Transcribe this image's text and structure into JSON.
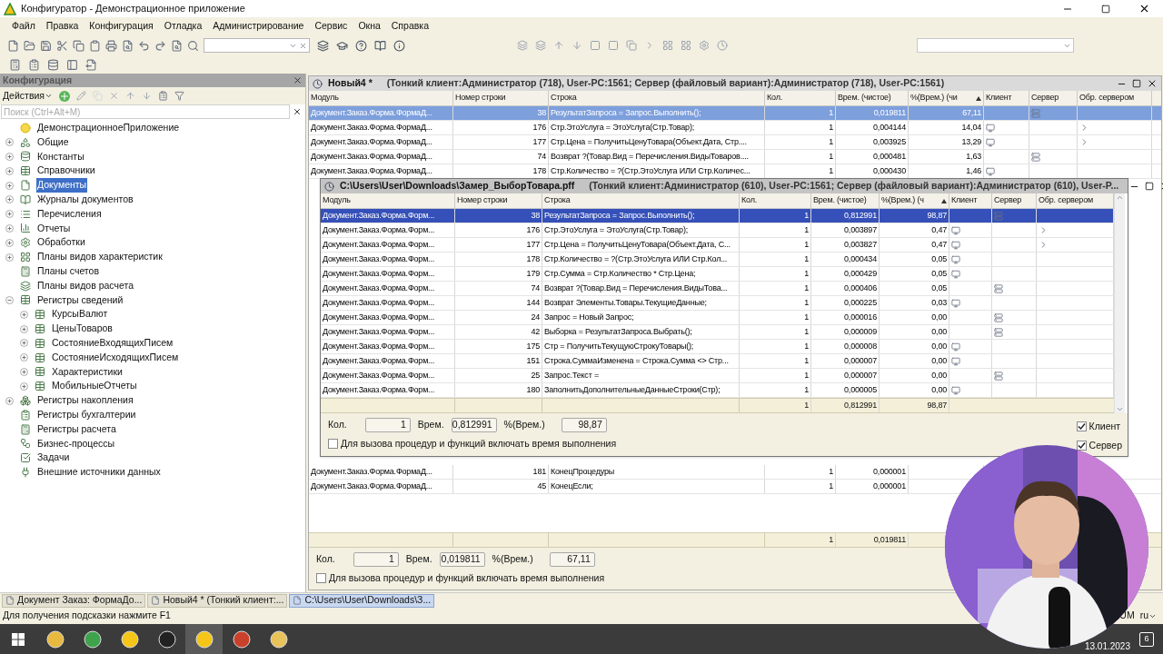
{
  "window": {
    "title": "Конфигуратор - Демонстрационное приложение"
  },
  "menu": [
    "Файл",
    "Правка",
    "Конфигурация",
    "Отладка",
    "Администрирование",
    "Сервис",
    "Окна",
    "Справка"
  ],
  "config_panel": {
    "title": "Конфигурация",
    "actions_label": "Действия",
    "search": {
      "placeholder": "Поиск (Ctrl+Alt+M)"
    },
    "tree": [
      {
        "label": "ДемонстрационноеПриложение",
        "selected": false,
        "children": [
          {
            "label": "Общие",
            "expanded": false,
            "selected": false
          },
          {
            "label": "Константы",
            "expanded": false,
            "selected": false
          },
          {
            "label": "Справочники",
            "expanded": false,
            "selected": false
          },
          {
            "label": "Документы",
            "expanded": false,
            "selected": true
          },
          {
            "label": "Журналы документов",
            "expanded": false,
            "selected": false
          },
          {
            "label": "Перечисления",
            "expanded": false,
            "selected": false
          },
          {
            "label": "Отчеты",
            "expanded": false,
            "selected": false
          },
          {
            "label": "Обработки",
            "expanded": false,
            "selected": false
          },
          {
            "label": "Планы видов характеристик",
            "expanded": false,
            "selected": false
          },
          {
            "label": "Планы счетов",
            "selected": false
          },
          {
            "label": "Планы видов расчета",
            "selected": false
          },
          {
            "label": "Регистры сведений",
            "expanded": true,
            "selected": false,
            "children": [
              {
                "label": "КурсыВалют",
                "expanded": false,
                "selected": false
              },
              {
                "label": "ЦеныТоваров",
                "expanded": false,
                "selected": false
              },
              {
                "label": "СостояниеВходящихПисем",
                "expanded": false,
                "selected": false
              },
              {
                "label": "СостояниеИсходящихПисем",
                "expanded": false,
                "selected": false
              },
              {
                "label": "Характеристики",
                "expanded": false,
                "selected": false
              },
              {
                "label": "МобильныеОтчеты",
                "expanded": false,
                "selected": false
              }
            ]
          },
          {
            "label": "Регистры накопления",
            "expanded": false,
            "selected": false
          },
          {
            "label": "Регистры бухгалтерии",
            "selected": false
          },
          {
            "label": "Регистры расчета",
            "selected": false
          },
          {
            "label": "Бизнес-процессы",
            "selected": false
          },
          {
            "label": "Задачи",
            "selected": false
          },
          {
            "label": "Внешние источники данных",
            "selected": false
          }
        ]
      }
    ]
  },
  "back_window": {
    "active": false,
    "title": "Новый4 *",
    "subtitle": "(Тонкий клиент:Администратор (718), User-PC:1561; Сервер (файловый вариант):Администратор (718), User-PC:1561)",
    "columns": [
      {
        "label": "Модуль",
        "sorted": false
      },
      {
        "label": "Номер строки",
        "sorted": false
      },
      {
        "label": "Строка",
        "sorted": false
      },
      {
        "label": "Кол.",
        "sorted": false
      },
      {
        "label": "Врем. (чистое)",
        "sorted": false
      },
      {
        "label": "%(Врем.) (чи",
        "sorted": true
      },
      {
        "label": "Клиент",
        "sorted": false
      },
      {
        "label": "Сервер",
        "sorted": false
      },
      {
        "label": "Обр. сервером",
        "sorted": false
      }
    ],
    "rows": [
      {
        "module": "Документ.Заказ.Форма.ФормаД...",
        "line": "38",
        "code": "РезультатЗапроса = Запрос.Выполнить();",
        "count": "1",
        "time": "0,019811",
        "percent": "67,11",
        "client": false,
        "server": true,
        "server_call": false,
        "selected": true
      },
      {
        "module": "Документ.Заказ.Форма.ФормаД...",
        "line": "176",
        "code": "Стр.ЭтоУслуга = ЭтоУслуга(Стр.Товар);",
        "count": "1",
        "time": "0,004144",
        "percent": "14,04",
        "client": true,
        "server": false,
        "server_call": true,
        "selected": false
      },
      {
        "module": "Документ.Заказ.Форма.ФормаД...",
        "line": "177",
        "code": "Стр.Цена = ПолучитьЦенуТовара(Объект.Дата, Стр....",
        "count": "1",
        "time": "0,003925",
        "percent": "13,29",
        "client": true,
        "server": false,
        "server_call": true,
        "selected": false
      },
      {
        "module": "Документ.Заказ.Форма.ФормаД...",
        "line": "74",
        "code": "Возврат ?(Товар.Вид = Перечисления.ВидыТоваров....",
        "count": "1",
        "time": "0,000481",
        "percent": "1,63",
        "client": false,
        "server": true,
        "server_call": false,
        "selected": false
      },
      {
        "module": "Документ.Заказ.Форма.ФормаД...",
        "line": "178",
        "code": "Стр.Количество = ?(Стр.ЭтоУслуга ИЛИ Стр.Количес...",
        "count": "1",
        "time": "0,000430",
        "percent": "1,46",
        "client": true,
        "server": false,
        "server_call": false,
        "selected": false
      }
    ],
    "lower_rows": [
      {
        "module": "Документ.Заказ.Форма.ФормаД...",
        "line": "181",
        "code": "КонецПроцедуры",
        "count": "1",
        "time": "0,000001",
        "selected": false
      },
      {
        "module": "Документ.Заказ.Форма.ФормаД...",
        "line": "45",
        "code": "КонецЕсли;",
        "count": "1",
        "time": "0,000001",
        "selected": false
      }
    ],
    "totals": {
      "count": "1",
      "time": "0,019811"
    },
    "summary": {
      "count_label": "Кол.",
      "count": "1",
      "time_label": "Врем.",
      "time": "0,019811",
      "percent_label": "%(Врем.)",
      "percent": "67,11"
    },
    "include_time": {
      "label": "Для вызова процедур и функций включать время выполнения",
      "checked": false
    }
  },
  "front_window": {
    "active": true,
    "title": "C:\\Users\\User\\Downloads\\Замер_ВыборТовара.pff",
    "subtitle": "(Тонкий клиент:Администратор (610), User-PC:1561; Сервер (файловый вариант):Администратор (610), User-P...",
    "columns": [
      {
        "label": "Модуль",
        "sorted": false
      },
      {
        "label": "Номер строки",
        "sorted": false
      },
      {
        "label": "Строка",
        "sorted": false
      },
      {
        "label": "Кол.",
        "sorted": false
      },
      {
        "label": "Врем. (чистое)",
        "sorted": false
      },
      {
        "label": "%(Врем.) (ч",
        "sorted": true
      },
      {
        "label": "Клиент",
        "sorted": false
      },
      {
        "label": "Сервер",
        "sorted": false
      },
      {
        "label": "Обр. сервером",
        "sorted": false
      }
    ],
    "rows": [
      {
        "module": "Документ.Заказ.Форма.Форм...",
        "line": "38",
        "code": "РезультатЗапроса = Запрос.Выполнить();",
        "count": "1",
        "time": "0,812991",
        "percent": "98,87",
        "client": false,
        "server": true,
        "server_call": false,
        "selected": true
      },
      {
        "module": "Документ.Заказ.Форма.Форм...",
        "line": "176",
        "code": "Стр.ЭтоУслуга = ЭтоУслуга(Стр.Товар);",
        "count": "1",
        "time": "0,003897",
        "percent": "0,47",
        "client": true,
        "server": false,
        "server_call": true,
        "selected": false
      },
      {
        "module": "Документ.Заказ.Форма.Форм...",
        "line": "177",
        "code": "Стр.Цена = ПолучитьЦенуТовара(Объект.Дата, С...",
        "count": "1",
        "time": "0,003827",
        "percent": "0,47",
        "client": true,
        "server": false,
        "server_call": true,
        "selected": false
      },
      {
        "module": "Документ.Заказ.Форма.Форм...",
        "line": "178",
        "code": "Стр.Количество = ?(Стр.ЭтоУслуга ИЛИ Стр.Кол...",
        "count": "1",
        "time": "0,000434",
        "percent": "0,05",
        "client": true,
        "server": false,
        "server_call": false,
        "selected": false
      },
      {
        "module": "Документ.Заказ.Форма.Форм...",
        "line": "179",
        "code": "Стр.Сумма = Стр.Количество * Стр.Цена;",
        "count": "1",
        "time": "0,000429",
        "percent": "0,05",
        "client": true,
        "server": false,
        "server_call": false,
        "selected": false
      },
      {
        "module": "Документ.Заказ.Форма.Форм...",
        "line": "74",
        "code": "Возврат ?(Товар.Вид = Перечисления.ВидыТова...",
        "count": "1",
        "time": "0,000406",
        "percent": "0,05",
        "client": false,
        "server": true,
        "server_call": false,
        "selected": false
      },
      {
        "module": "Документ.Заказ.Форма.Форм...",
        "line": "144",
        "code": "Возврат Элементы.Товары.ТекущиеДанные;",
        "count": "1",
        "time": "0,000225",
        "percent": "0,03",
        "client": true,
        "server": false,
        "server_call": false,
        "selected": false
      },
      {
        "module": "Документ.Заказ.Форма.Форм...",
        "line": "24",
        "code": "Запрос = Новый Запрос;",
        "count": "1",
        "time": "0,000016",
        "percent": "0,00",
        "client": false,
        "server": true,
        "server_call": false,
        "selected": false
      },
      {
        "module": "Документ.Заказ.Форма.Форм...",
        "line": "42",
        "code": "Выборка = РезультатЗапроса.Выбрать();",
        "count": "1",
        "time": "0,000009",
        "percent": "0,00",
        "client": false,
        "server": true,
        "server_call": false,
        "selected": false
      },
      {
        "module": "Документ.Заказ.Форма.Форм...",
        "line": "175",
        "code": "Стр = ПолучитьТекущуюСтрокуТовары();",
        "count": "1",
        "time": "0,000008",
        "percent": "0,00",
        "client": true,
        "server": false,
        "server_call": false,
        "selected": false
      },
      {
        "module": "Документ.Заказ.Форма.Форм...",
        "line": "151",
        "code": "Строка.СуммаИзменена = Строка.Сумма <> Стр...",
        "count": "1",
        "time": "0,000007",
        "percent": "0,00",
        "client": true,
        "server": false,
        "server_call": false,
        "selected": false
      },
      {
        "module": "Документ.Заказ.Форма.Форм...",
        "line": "25",
        "code": "Запрос.Текст =",
        "count": "1",
        "time": "0,000007",
        "percent": "0,00",
        "client": false,
        "server": true,
        "server_call": false,
        "selected": false
      },
      {
        "module": "Документ.Заказ.Форма.Форм...",
        "line": "180",
        "code": "ЗаполнитьДополнительныеДанныеСтроки(Стр);",
        "count": "1",
        "time": "0,000005",
        "percent": "0,00",
        "client": true,
        "server": false,
        "server_call": false,
        "selected": false
      }
    ],
    "totals": {
      "count": "1",
      "time": "0,812991",
      "percent": "98,87"
    },
    "summary": {
      "count_label": "Кол.",
      "count": "1",
      "time_label": "Врем.",
      "time": "0,812991",
      "percent_label": "%(Врем.)",
      "percent": "98,87"
    },
    "include_time": {
      "label": "Для вызова процедур и функций включать время выполнения",
      "checked": false
    },
    "flags": [
      {
        "label": "Клиент",
        "checked": true
      },
      {
        "label": "Сервер",
        "checked": true
      }
    ]
  },
  "window_tabs": [
    {
      "label": "Документ Заказ: ФормаДо...",
      "selected": false
    },
    {
      "label": "Новый4 *    (Тонкий клиент:...",
      "selected": false
    },
    {
      "label": "C:\\Users\\User\\Downloads\\З...",
      "selected": true
    }
  ],
  "status_bar": {
    "hint": "Для получения подсказки нажмите F1",
    "indicator": "UM",
    "language": "ru"
  },
  "taskbar": {
    "date": "13.01.2023",
    "notifications": "6"
  },
  "webcam": {
    "kind": "picture"
  }
}
